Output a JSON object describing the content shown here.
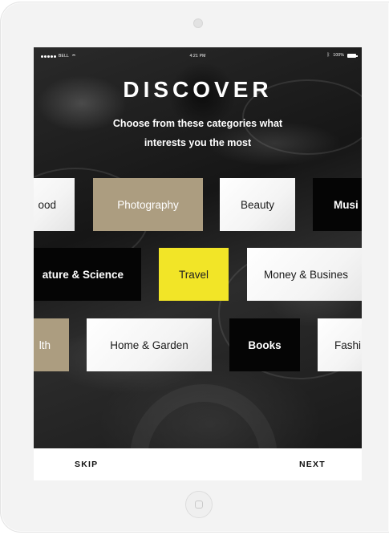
{
  "status_bar": {
    "carrier": "BELL",
    "time": "4:21 PM",
    "battery": "100%"
  },
  "header": {
    "title": "DISCOVER",
    "subtitle": "Choose from these categories what interests you the most"
  },
  "categories": {
    "row1": [
      "ood",
      "Photography",
      "Beauty",
      "Musi"
    ],
    "row2": [
      "ature & Science",
      "Travel",
      "Money & Busines"
    ],
    "row3": [
      "lth",
      "Home & Garden",
      "Books",
      "Fashi"
    ]
  },
  "footer": {
    "skip_label": "SKIP",
    "next_label": "NEXT"
  },
  "colors": {
    "gold": "#ac9d80",
    "yellow": "#f2e527",
    "black": "#050505"
  }
}
